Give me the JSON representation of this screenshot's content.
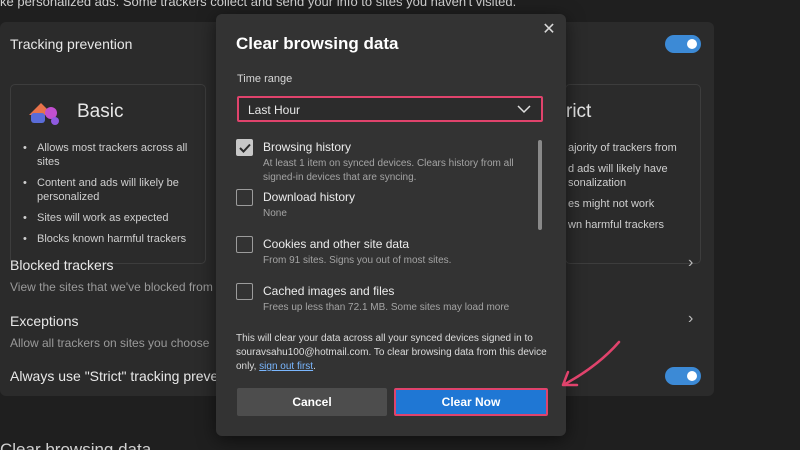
{
  "background": {
    "top_text": "ke personalized ads. Some trackers collect and send your info to sites you haven't visited.",
    "tracking_prevention": {
      "title": "Tracking prevention",
      "toggle_on": true
    },
    "basic": {
      "title": "Basic",
      "bullets": [
        "Allows most trackers across all sites",
        "Content and ads will likely be personalized",
        "Sites will work as expected",
        "Blocks known harmful trackers"
      ]
    },
    "strict": {
      "title": "rict",
      "bullets": [
        "ajority of trackers from",
        "d ads will likely have sonalization",
        "es might not work",
        "wn harmful trackers"
      ]
    },
    "blocked_trackers": {
      "title": "Blocked trackers",
      "sub": "View the sites that we've blocked from tra"
    },
    "exceptions": {
      "title": "Exceptions",
      "sub": "Allow all trackers on sites you choose"
    },
    "always_strict": {
      "title": "Always use \"Strict\" tracking prevent",
      "toggle_on": true
    },
    "bottom_text": "Clear browsing data"
  },
  "dialog": {
    "title": "Clear browsing data",
    "close_icon": "close-icon",
    "time_range_label": "Time range",
    "time_range_value": "Last Hour",
    "options": [
      {
        "name": "Browsing history",
        "desc": "At least 1 item on synced devices. Clears history from all signed-in devices that are syncing.",
        "checked": true
      },
      {
        "name": "Download history",
        "desc": "None",
        "checked": false
      },
      {
        "name": "Cookies and other site data",
        "desc": "From 91 sites. Signs you out of most sites.",
        "checked": false
      },
      {
        "name": "Cached images and files",
        "desc": "Frees up less than 72.1 MB. Some sites may load more",
        "checked": false
      }
    ],
    "note_text": "This will clear your data across all your synced devices signed in to souravsahu100@hotmail.com. To clear browsing data from this device only,",
    "note_link": "sign out first",
    "note_end": ".",
    "cancel_label": "Cancel",
    "clear_label": "Clear Now"
  },
  "colors": {
    "accent": "#1f77d4",
    "highlight": "#e0436c",
    "dialog_bg": "#333333",
    "page_bg": "#1f1f1f"
  }
}
